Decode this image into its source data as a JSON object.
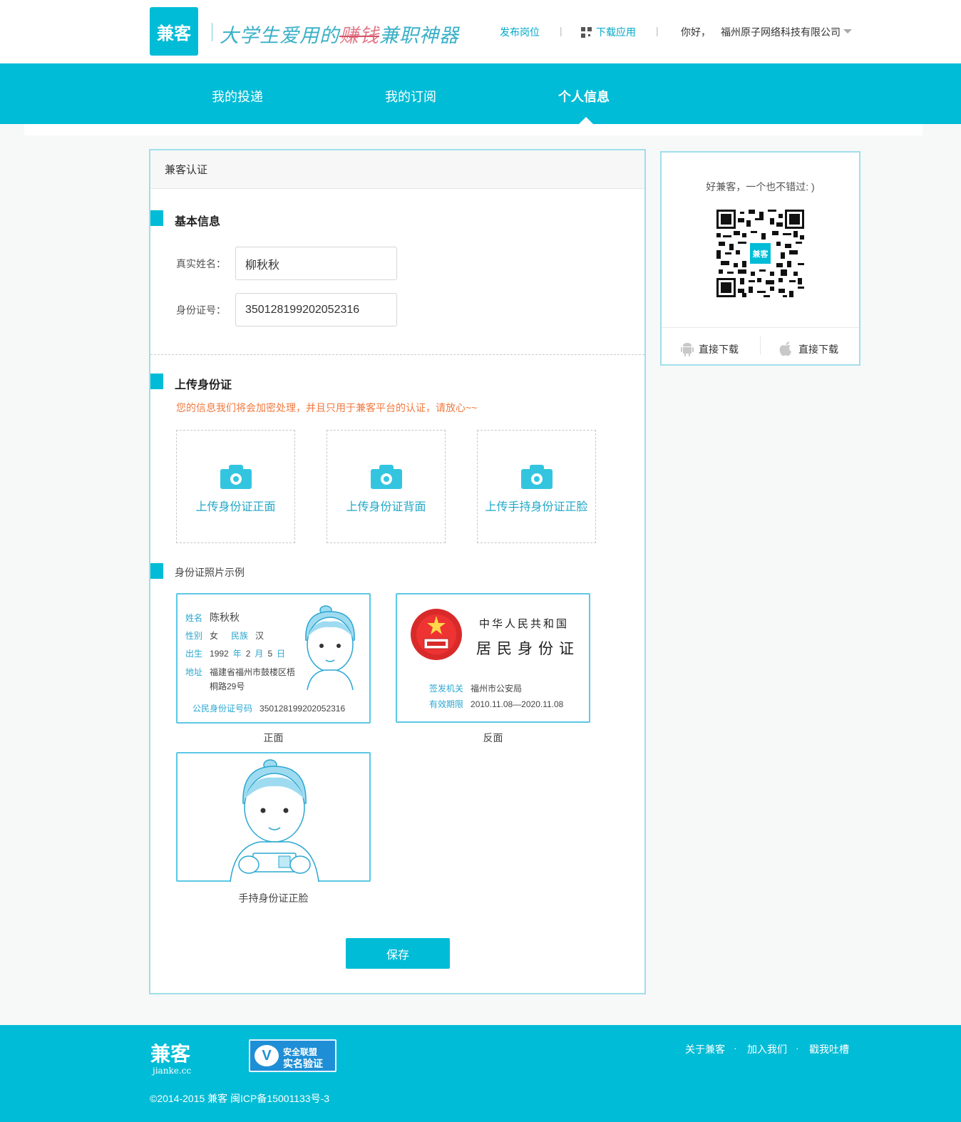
{
  "header": {
    "logo_text": "兼客",
    "slogan_pre": "大学生爱用的",
    "slogan_strike": "赚钱",
    "slogan_post": "兼职神器",
    "post_job": "发布岗位",
    "download_app": "下载应用",
    "greeting": "你好，",
    "company": "福州原子网络科技有限公司"
  },
  "nav": {
    "tabs": [
      {
        "label": "我的投递"
      },
      {
        "label": "我的订阅"
      },
      {
        "label": "个人信息"
      }
    ],
    "active_index": 2
  },
  "panel": {
    "title": "兼客认证",
    "basic_info": {
      "title": "基本信息",
      "name_label": "真实姓名：",
      "name_value": "柳秋秋",
      "id_label": "身份证号：",
      "id_value": "350128199202052316"
    },
    "upload": {
      "title": "上传身份证",
      "notice": "您的信息我们将会加密处理，并且只用于兼客平台的认证，请放心~~",
      "boxes": [
        {
          "label": "上传身份证正面"
        },
        {
          "label": "上传身份证背面"
        },
        {
          "label": "上传手持身份证正脸"
        }
      ]
    },
    "sample": {
      "title": "身份证照片示例",
      "front": {
        "caption": "正面",
        "name_k": "姓名",
        "name_v": "陈秋秋",
        "sex_k": "性别",
        "sex_v": "女",
        "nation_k": "民族",
        "nation_v": "汉",
        "birth_k": "出生",
        "birth_year": "1992",
        "year_unit": "年",
        "birth_month": "2",
        "month_unit": "月",
        "birth_day": "5",
        "day_unit": "日",
        "addr_k": "地址",
        "addr_v1": "福建省福州市鼓楼区梧",
        "addr_v2": "桐路29号",
        "idno_k": "公民身份证号码",
        "idno_v": "350128199202052316"
      },
      "back": {
        "caption": "反面",
        "country": "中华人民共和国",
        "doc_title": "居民身份证",
        "issuer_k": "签发机关",
        "issuer_v": "福州市公安局",
        "valid_k": "有效期限",
        "valid_v": "2010.11.08—2020.11.08"
      },
      "handheld": {
        "caption": "手持身份证正脸"
      }
    },
    "save_label": "保存"
  },
  "side": {
    "tagline": "好兼客，一个也不错过: )",
    "qr_logo": "兼客",
    "android_download": "直接下载",
    "ios_download": "直接下载"
  },
  "footer": {
    "logo": "兼客",
    "domain": "jianke.cc",
    "badge_line1": "安全联盟",
    "badge_line2": "实名验证",
    "link_about": "关于兼客",
    "link_join": "加入我们",
    "link_feedback": "戳我吐槽",
    "dot": "·",
    "copyright": "©2014-2015 兼客 闽ICP备15001133号-3"
  },
  "colors": {
    "brand": "#00bcd6",
    "notice": "#f07a40",
    "link": "#00a8c8"
  }
}
